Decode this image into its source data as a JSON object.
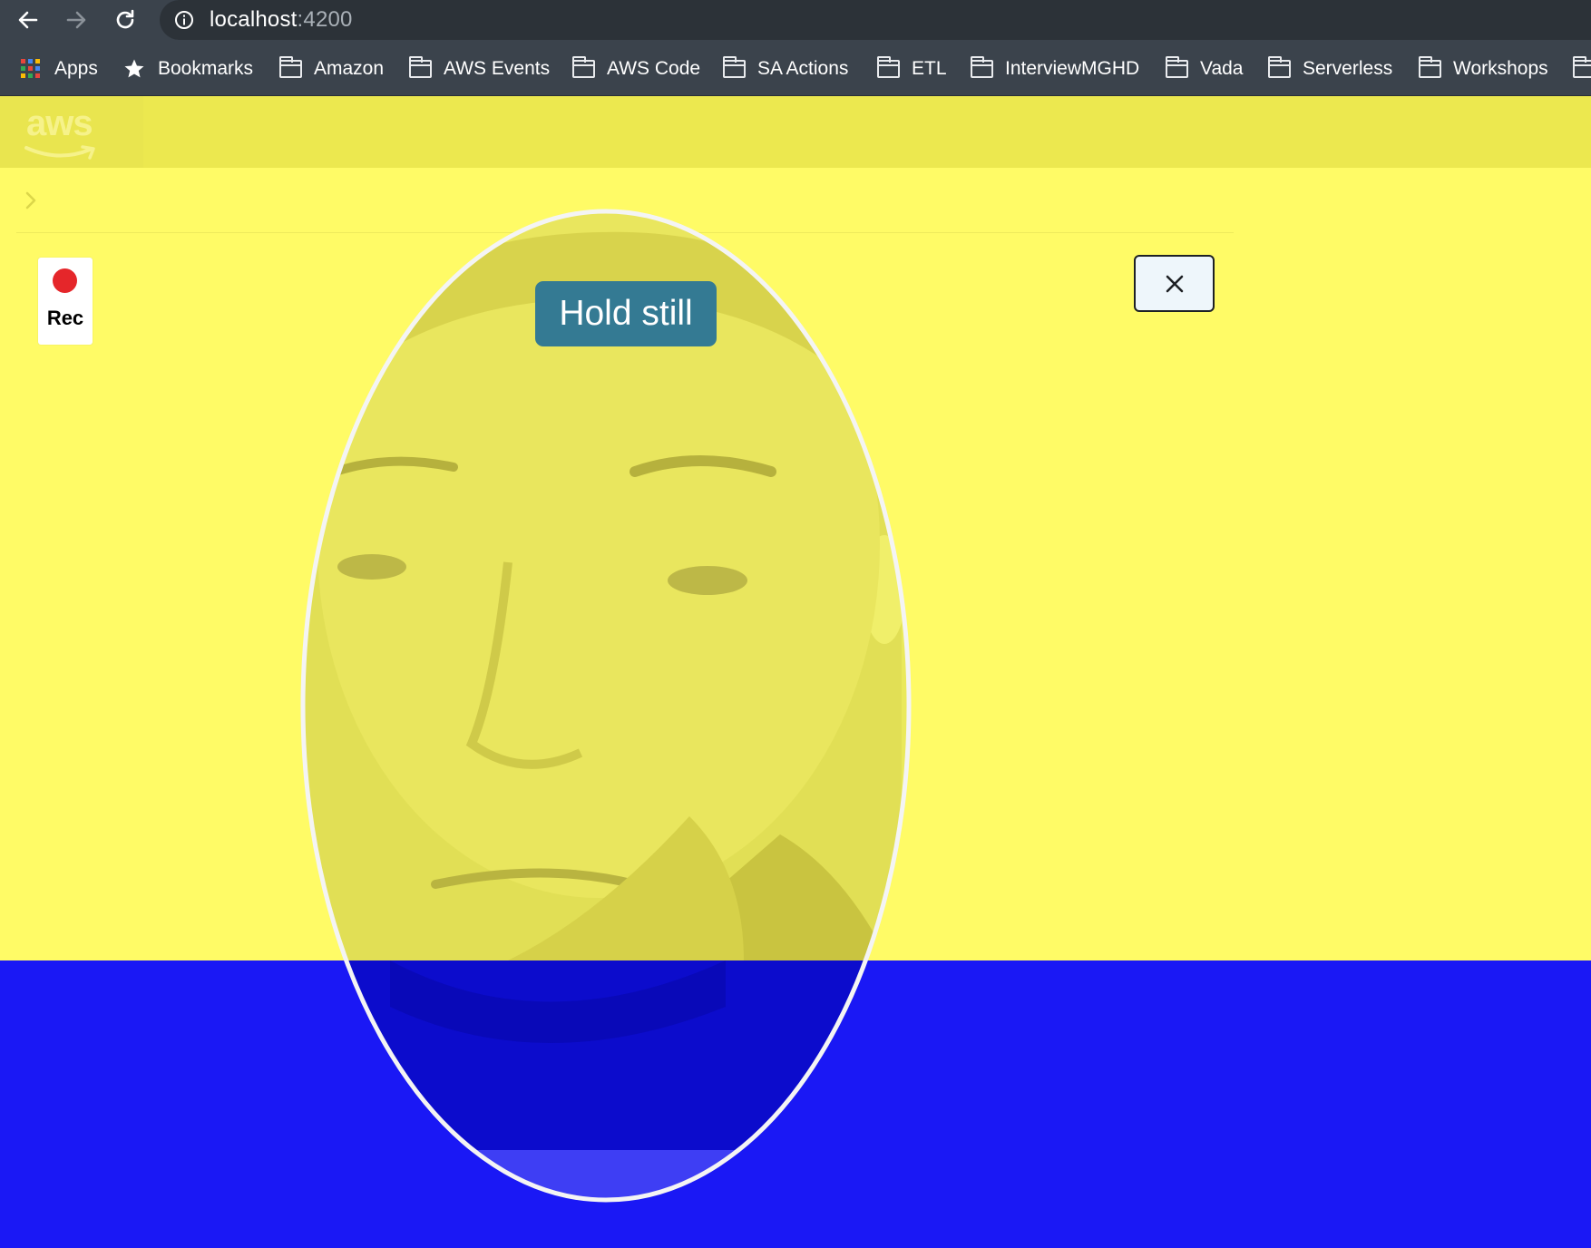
{
  "browser": {
    "url_host": "localhost",
    "url_port": ":4200",
    "bookmarks": [
      {
        "label": "Apps",
        "icon": "apps-grid-icon"
      },
      {
        "label": "Bookmarks",
        "icon": "star-icon"
      },
      {
        "label": "Amazon",
        "icon": "folder-icon"
      },
      {
        "label": "AWS Events",
        "icon": "folder-icon"
      },
      {
        "label": "AWS Code",
        "icon": "folder-icon"
      },
      {
        "label": "SA Actions",
        "icon": "folder-icon"
      },
      {
        "label": "ETL",
        "icon": "folder-icon"
      },
      {
        "label": "InterviewMGHD",
        "icon": "folder-icon"
      },
      {
        "label": "Vada",
        "icon": "folder-icon"
      },
      {
        "label": "Serverless",
        "icon": "folder-icon"
      },
      {
        "label": "Workshops",
        "icon": "folder-icon"
      }
    ]
  },
  "header": {
    "logo_text": "aws"
  },
  "liveness": {
    "recording_label": "Rec",
    "instruction": "Hold still",
    "close_icon": "close-icon"
  },
  "colors": {
    "flash_top": "#fffb66",
    "flash_bottom": "#1a18f5",
    "instruction_badge": "#347a93",
    "rec_dot": "#e5262a"
  }
}
